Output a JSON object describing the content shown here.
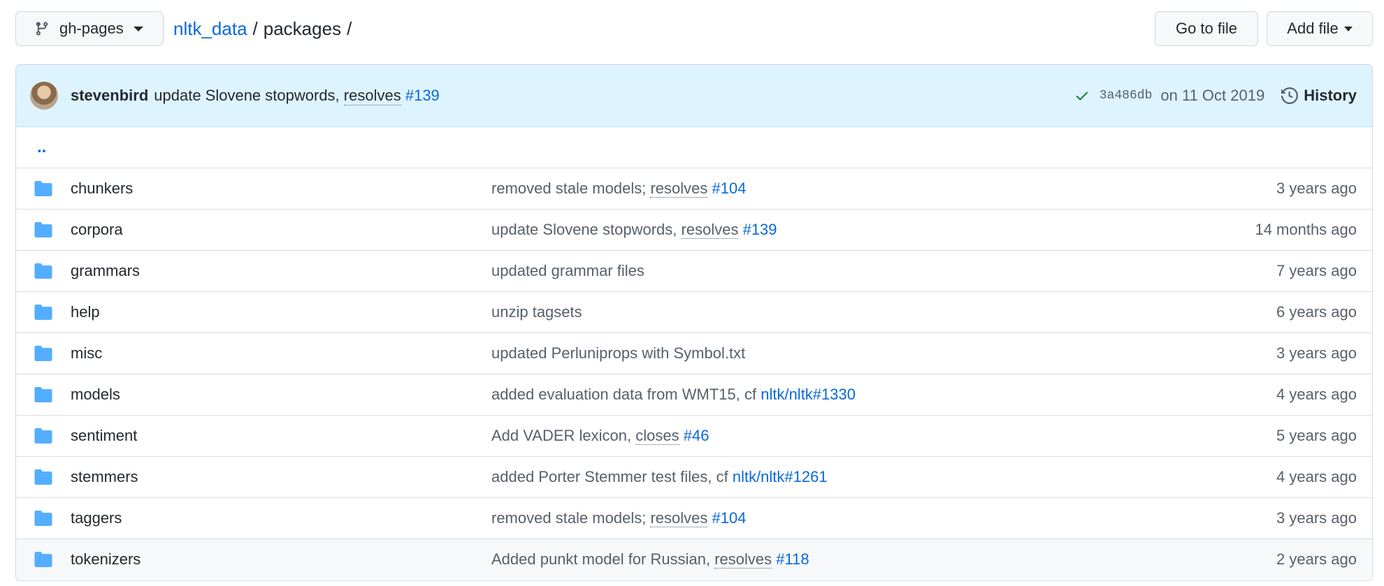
{
  "branch": {
    "label": "gh-pages"
  },
  "breadcrumb": {
    "repo": "nltk_data",
    "sep": "/",
    "folder": "packages",
    "trail": "/"
  },
  "actions": {
    "go_to_file": "Go to file",
    "add_file": "Add file"
  },
  "commit": {
    "author": "stevenbird",
    "message": "update Slovene stopwords,",
    "resolves": "resolves",
    "issue": "#139",
    "sha": "3a486db",
    "date": "on 11 Oct 2019",
    "history": "History"
  },
  "parent": "..",
  "rows": [
    {
      "name": "chunkers",
      "msg": "removed stale models;",
      "kw": "resolves",
      "ref": "#104",
      "age": "3 years ago"
    },
    {
      "name": "corpora",
      "msg": "update Slovene stopwords,",
      "kw": "resolves",
      "ref": "#139",
      "age": "14 months ago"
    },
    {
      "name": "grammars",
      "msg": "updated grammar files",
      "kw": "",
      "ref": "",
      "age": "7 years ago"
    },
    {
      "name": "help",
      "msg": "unzip tagsets",
      "kw": "",
      "ref": "",
      "age": "6 years ago"
    },
    {
      "name": "misc",
      "msg": "updated Perluniprops with Symbol.txt",
      "kw": "",
      "ref": "",
      "age": "3 years ago"
    },
    {
      "name": "models",
      "msg": "added evaluation data from WMT15, cf",
      "kw": "",
      "ref": "nltk/nltk#1330",
      "age": "4 years ago"
    },
    {
      "name": "sentiment",
      "msg": "Add VADER lexicon,",
      "kw": "closes",
      "ref": "#46",
      "age": "5 years ago"
    },
    {
      "name": "stemmers",
      "msg": "added Porter Stemmer test files, cf",
      "kw": "",
      "ref": "nltk/nltk#1261",
      "age": "4 years ago"
    },
    {
      "name": "taggers",
      "msg": "removed stale models;",
      "kw": "resolves",
      "ref": "#104",
      "age": "3 years ago"
    },
    {
      "name": "tokenizers",
      "msg": "Added punkt model for Russian,",
      "kw": "resolves",
      "ref": "#118",
      "age": "2 years ago"
    }
  ],
  "colors": {
    "link": "#0969da",
    "folder": "#54aeff",
    "commit_bg": "#ddf4ff",
    "check": "#1a7f37"
  }
}
